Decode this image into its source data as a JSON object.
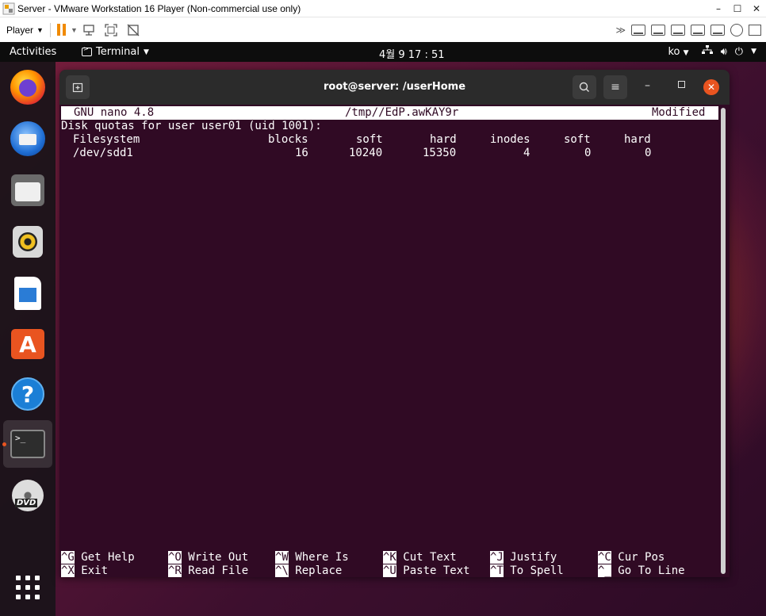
{
  "vmware": {
    "title": "Server - VMware Workstation 16 Player (Non-commercial use only)",
    "player_label": "Player",
    "controls": [
      "minimize",
      "maximize",
      "close"
    ]
  },
  "topbar": {
    "activities": "Activities",
    "app_menu": "Terminal",
    "clock": "4월 9  17 : 51",
    "language": "ko"
  },
  "dock": {
    "apps": [
      "Firefox",
      "Thunderbird",
      "Files",
      "Rhythmbox",
      "LibreOffice Writer",
      "Ubuntu Software",
      "Help",
      "Terminal",
      "DVD"
    ],
    "active": "Terminal"
  },
  "terminal": {
    "title": "root@server: /userHome"
  },
  "nano": {
    "version": "GNU nano 4.8",
    "filename": "/tmp//EdP.awKAY9r",
    "status": "Modified",
    "header_line": "Disk quotas for user user01 (uid 1001):",
    "columns": [
      "Filesystem",
      "blocks",
      "soft",
      "hard",
      "inodes",
      "soft",
      "hard"
    ],
    "rows": [
      [
        "/dev/sdd1",
        "16",
        "10240",
        "15350",
        "4",
        "0",
        "0"
      ]
    ],
    "shortcuts": [
      {
        "key": "^G",
        "label": "Get Help"
      },
      {
        "key": "^O",
        "label": "Write Out"
      },
      {
        "key": "^W",
        "label": "Where Is"
      },
      {
        "key": "^K",
        "label": "Cut Text"
      },
      {
        "key": "^J",
        "label": "Justify"
      },
      {
        "key": "^C",
        "label": "Cur Pos"
      },
      {
        "key": "^X",
        "label": "Exit"
      },
      {
        "key": "^R",
        "label": "Read File"
      },
      {
        "key": "^\\",
        "label": "Replace"
      },
      {
        "key": "^U",
        "label": "Paste Text"
      },
      {
        "key": "^T",
        "label": "To Spell"
      },
      {
        "key": "^_",
        "label": "Go To Line"
      }
    ]
  },
  "colors": {
    "terminal_bg": "#300a24",
    "ubuntu_orange": "#e95420",
    "vmware_pause": "#f08a00"
  }
}
